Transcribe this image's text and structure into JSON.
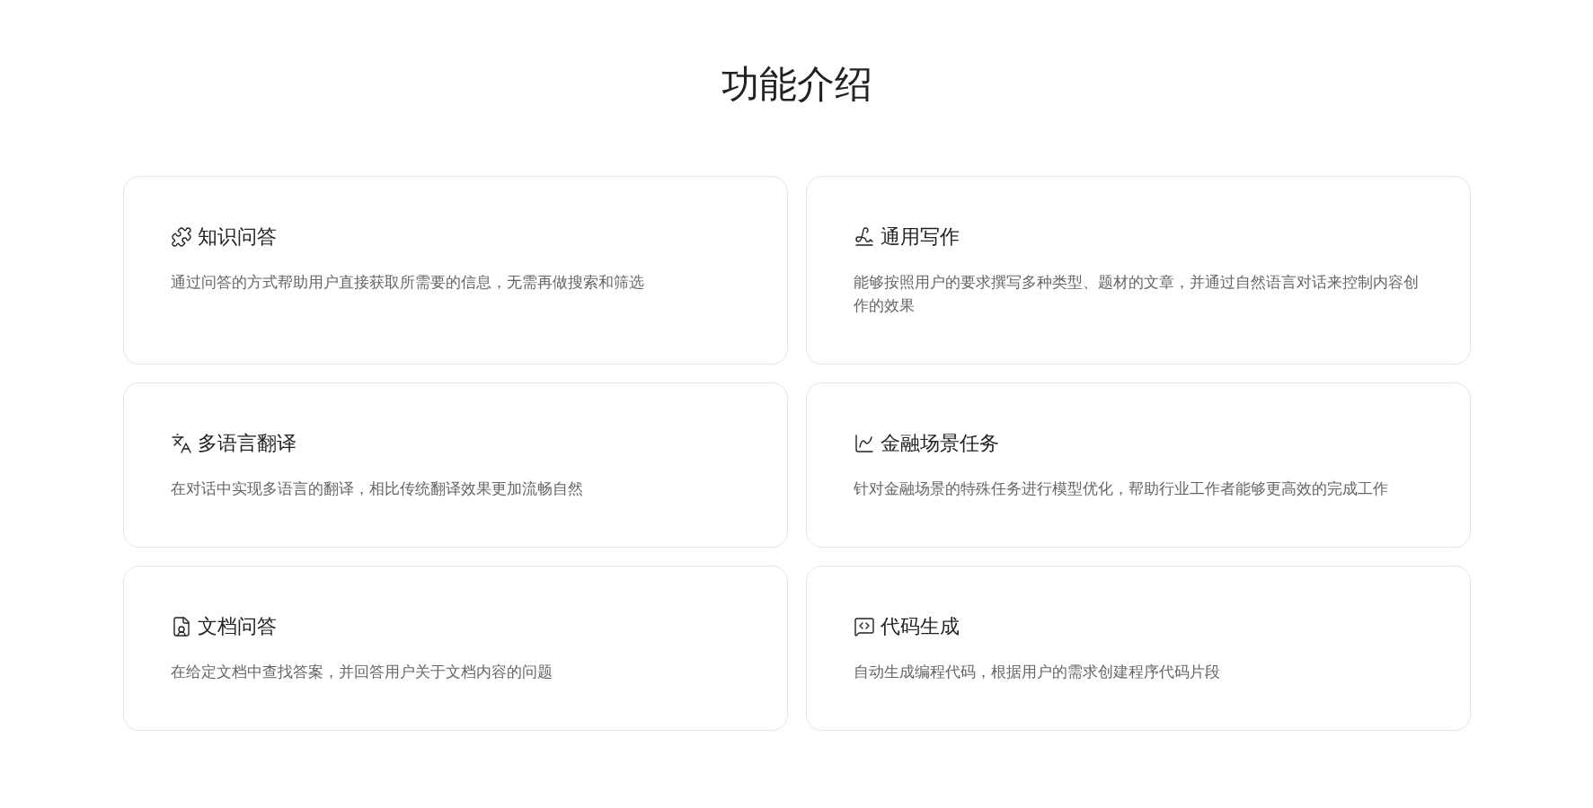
{
  "title": "功能介绍",
  "features": [
    {
      "title": "知识问答",
      "description": "通过问答的方式帮助用户直接获取所需要的信息，无需再做搜索和筛选"
    },
    {
      "title": "通用写作",
      "description": "能够按照用户的要求撰写多种类型、题材的文章，并通过自然语言对话来控制内容创作的效果"
    },
    {
      "title": "多语言翻译",
      "description": "在对话中实现多语言的翻译，相比传统翻译效果更加流畅自然"
    },
    {
      "title": "金融场景任务",
      "description": "针对金融场景的特殊任务进行模型优化，帮助行业工作者能够更高效的完成工作"
    },
    {
      "title": "文档问答",
      "description": "在给定文档中查找答案，并回答用户关于文档内容的问题"
    },
    {
      "title": "代码生成",
      "description": "自动生成编程代码，根据用户的需求创建程序代码片段"
    }
  ]
}
